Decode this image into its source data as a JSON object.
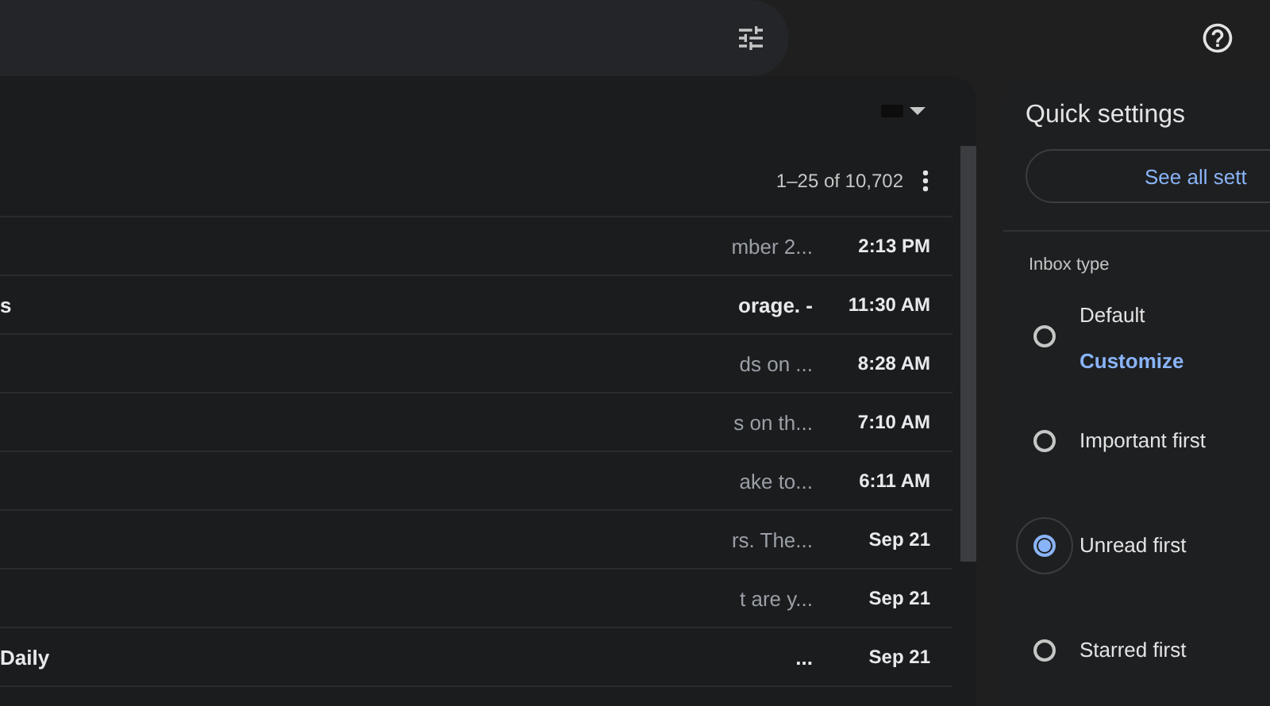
{
  "list": {
    "page_range": "1–25 of 10,702",
    "rows": [
      {
        "sender": "",
        "snippet": "mber 2...",
        "time": "2:13 PM",
        "unread": false
      },
      {
        "sender": "s",
        "snippet": "orage. -",
        "time": "11:30 AM",
        "unread": true
      },
      {
        "sender": "",
        "snippet": "ds on ...",
        "time": "8:28 AM",
        "unread": false
      },
      {
        "sender": "",
        "snippet": "s on th...",
        "time": "7:10 AM",
        "unread": false
      },
      {
        "sender": "",
        "snippet": "ake to...",
        "time": "6:11 AM",
        "unread": false
      },
      {
        "sender": "",
        "snippet": "rs. The...",
        "time": "Sep 21",
        "unread": false
      },
      {
        "sender": "",
        "snippet": "t are y...",
        "time": "Sep 21",
        "unread": false
      },
      {
        "sender": "Daily",
        "snippet": "...",
        "time": "Sep 21",
        "unread": true
      }
    ]
  },
  "quick_settings": {
    "title": "Quick settings",
    "see_all": "See all sett",
    "section": "Inbox type",
    "options": [
      {
        "label": "Default",
        "link": "Customize",
        "selected": false
      },
      {
        "label": "Important first",
        "selected": false
      },
      {
        "label": "Unread first",
        "selected": true
      },
      {
        "label": "Starred first",
        "selected": false
      }
    ]
  }
}
